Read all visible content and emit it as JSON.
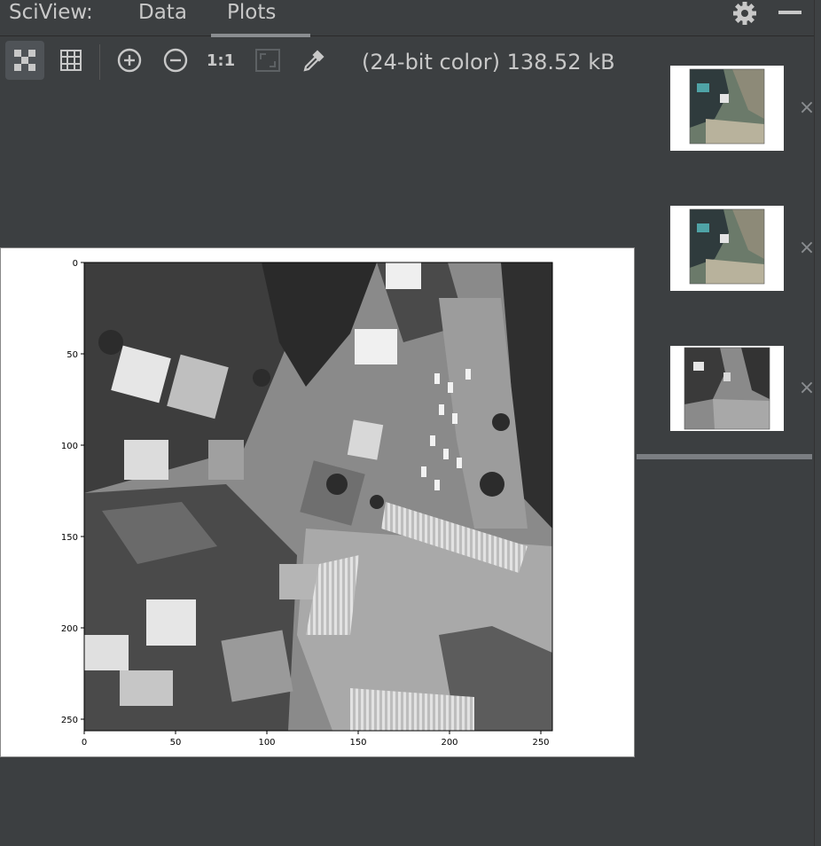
{
  "header": {
    "app_title": "SciView:",
    "tabs": [
      {
        "label": "Data",
        "active": false
      },
      {
        "label": "Plots",
        "active": true
      }
    ],
    "settings_icon": "gear-icon",
    "minimize_icon": "minimize-icon"
  },
  "toolbar": {
    "buttons": [
      {
        "name": "chessboard-background",
        "icon": "checkerboard-icon",
        "active": true
      },
      {
        "name": "grid",
        "icon": "grid-icon",
        "active": false
      },
      {
        "name": "zoom-in",
        "icon": "zoom-in-icon",
        "active": false
      },
      {
        "name": "zoom-out",
        "icon": "zoom-out-icon",
        "active": false
      },
      {
        "name": "actual-size",
        "label": "1:1",
        "active": false
      },
      {
        "name": "fit-zoom",
        "icon": "fit-zoom-icon",
        "active": false
      },
      {
        "name": "color-picker",
        "icon": "eyedropper-icon",
        "active": false
      }
    ],
    "image_info": "(24-bit color) 138.52 kB"
  },
  "plot": {
    "x_ticks": [
      "0",
      "50",
      "100",
      "150",
      "200",
      "250"
    ],
    "y_ticks": [
      "0",
      "50",
      "100",
      "150",
      "200",
      "250"
    ],
    "image": "grayscale aerial city photo"
  },
  "thumbnails": [
    {
      "kind": "color aerial image",
      "close_icon": "close-icon"
    },
    {
      "kind": "color aerial image",
      "close_icon": "close-icon"
    },
    {
      "kind": "grayscale aerial image",
      "close_icon": "close-icon"
    }
  ],
  "colors": {
    "background": "#3c3f41",
    "text": "#c8c8c8",
    "active_tab_underline": "#8a8d90"
  }
}
